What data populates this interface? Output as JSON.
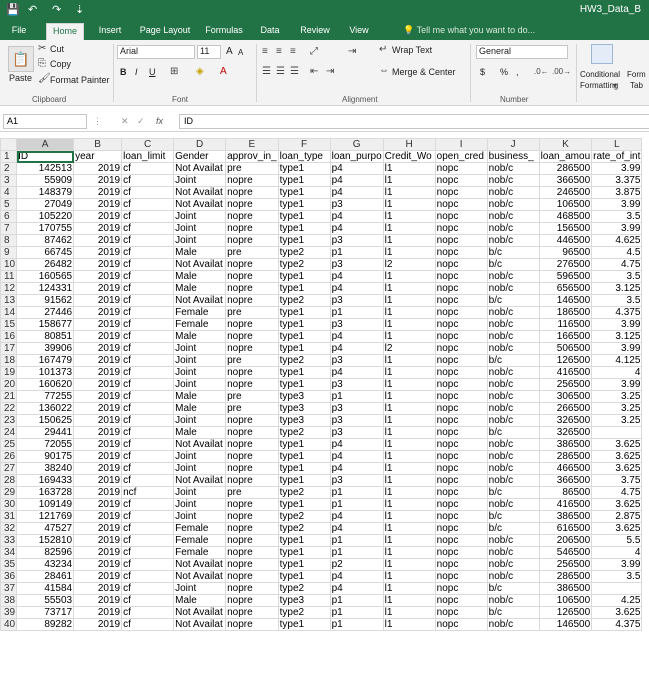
{
  "window": {
    "title": "HW3_Data_B",
    "quick_access": [
      "💾",
      "↶",
      "↷",
      "⇣"
    ]
  },
  "ribbon_tabs": [
    "File",
    "Home",
    "Insert",
    "Page Layout",
    "Formulas",
    "Data",
    "Review",
    "View"
  ],
  "tell_me": "Tell me what you want to do...",
  "clipboard": {
    "paste": "Paste",
    "cut": "Cut",
    "copy": "Copy",
    "format_painter": "Format Painter",
    "group": "Clipboard"
  },
  "font": {
    "name": "Arial",
    "size": "11",
    "bold": "B",
    "italic": "I",
    "underline": "U",
    "grow": "A",
    "shrink": "A",
    "group": "Font"
  },
  "alignment": {
    "wrap": "Wrap Text",
    "merge": "Merge & Center",
    "group": "Alignment"
  },
  "number": {
    "format": "General",
    "currency": "$",
    "percent": "%",
    "comma": ",",
    "group": "Number"
  },
  "styles": {
    "conditional": "Conditional",
    "formatting": "Formatting",
    "format_as": "Form",
    "table": "Tab"
  },
  "formula_bar": {
    "cell_ref": "A1",
    "cancel": "✕",
    "enter": "✓",
    "fx": "fx",
    "content": "ID"
  },
  "columns": [
    "A",
    "B",
    "C",
    "D",
    "E",
    "F",
    "G",
    "H",
    "I",
    "J",
    "K",
    "L"
  ],
  "header_row": [
    "ID",
    "year",
    "loan_limit",
    "Gender",
    "approv_in_",
    "loan_type",
    "loan_purpo",
    "Credit_Wo",
    "open_cred",
    "business_",
    "loan_amou",
    "rate_of_int"
  ],
  "rows": [
    [
      "142513",
      "2019",
      "cf",
      "Not Availat",
      "pre",
      "type1",
      "p4",
      "l1",
      "nopc",
      "nob/c",
      "286500",
      "3.99"
    ],
    [
      "55909",
      "2019",
      "cf",
      "Joint",
      "nopre",
      "type1",
      "p4",
      "l1",
      "nopc",
      "nob/c",
      "366500",
      "3.375"
    ],
    [
      "148379",
      "2019",
      "cf",
      "Not Availat",
      "nopre",
      "type1",
      "p4",
      "l1",
      "nopc",
      "nob/c",
      "246500",
      "3.875"
    ],
    [
      "27049",
      "2019",
      "cf",
      "Not Availat",
      "nopre",
      "type1",
      "p3",
      "l1",
      "nopc",
      "nob/c",
      "106500",
      "3.99"
    ],
    [
      "105220",
      "2019",
      "cf",
      "Joint",
      "nopre",
      "type1",
      "p4",
      "l1",
      "nopc",
      "nob/c",
      "468500",
      "3.5"
    ],
    [
      "170755",
      "2019",
      "cf",
      "Joint",
      "nopre",
      "type1",
      "p4",
      "l1",
      "nopc",
      "nob/c",
      "156500",
      "3.99"
    ],
    [
      "87462",
      "2019",
      "cf",
      "Joint",
      "nopre",
      "type1",
      "p3",
      "l1",
      "nopc",
      "nob/c",
      "446500",
      "4.625"
    ],
    [
      "66745",
      "2019",
      "cf",
      "Male",
      "pre",
      "type2",
      "p1",
      "l1",
      "nopc",
      "b/c",
      "96500",
      "4.5"
    ],
    [
      "26482",
      "2019",
      "cf",
      "Not Availat",
      "nopre",
      "type2",
      "p3",
      "l2",
      "nopc",
      "b/c",
      "276500",
      "4.75"
    ],
    [
      "160565",
      "2019",
      "cf",
      "Male",
      "nopre",
      "type1",
      "p4",
      "l1",
      "nopc",
      "nob/c",
      "596500",
      "3.5"
    ],
    [
      "124331",
      "2019",
      "cf",
      "Male",
      "nopre",
      "type1",
      "p4",
      "l1",
      "nopc",
      "nob/c",
      "656500",
      "3.125"
    ],
    [
      "91562",
      "2019",
      "cf",
      "Not Availat",
      "nopre",
      "type2",
      "p3",
      "l1",
      "nopc",
      "b/c",
      "146500",
      "3.5"
    ],
    [
      "27446",
      "2019",
      "cf",
      "Female",
      "pre",
      "type1",
      "p1",
      "l1",
      "nopc",
      "nob/c",
      "186500",
      "4.375"
    ],
    [
      "158677",
      "2019",
      "cf",
      "Female",
      "nopre",
      "type1",
      "p3",
      "l1",
      "nopc",
      "nob/c",
      "116500",
      "3.99"
    ],
    [
      "80851",
      "2019",
      "cf",
      "Male",
      "nopre",
      "type1",
      "p4",
      "l1",
      "nopc",
      "nob/c",
      "166500",
      "3.125"
    ],
    [
      "39906",
      "2019",
      "cf",
      "Joint",
      "nopre",
      "type1",
      "p4",
      "l2",
      "nopc",
      "nob/c",
      "506500",
      "3.99"
    ],
    [
      "167479",
      "2019",
      "cf",
      "Joint",
      "pre",
      "type2",
      "p3",
      "l1",
      "nopc",
      "b/c",
      "126500",
      "4.125"
    ],
    [
      "101373",
      "2019",
      "cf",
      "Joint",
      "nopre",
      "type1",
      "p4",
      "l1",
      "nopc",
      "nob/c",
      "416500",
      "4"
    ],
    [
      "160620",
      "2019",
      "cf",
      "Joint",
      "nopre",
      "type1",
      "p3",
      "l1",
      "nopc",
      "nob/c",
      "256500",
      "3.99"
    ],
    [
      "77255",
      "2019",
      "cf",
      "Male",
      "pre",
      "type3",
      "p1",
      "l1",
      "nopc",
      "nob/c",
      "306500",
      "3.25"
    ],
    [
      "136022",
      "2019",
      "cf",
      "Male",
      "pre",
      "type3",
      "p3",
      "l1",
      "nopc",
      "nob/c",
      "266500",
      "3.25"
    ],
    [
      "150625",
      "2019",
      "cf",
      "Joint",
      "nopre",
      "type3",
      "p3",
      "l1",
      "nopc",
      "nob/c",
      "326500",
      "3.25"
    ],
    [
      "29441",
      "2019",
      "cf",
      "Male",
      "nopre",
      "type2",
      "p3",
      "l1",
      "nopc",
      "b/c",
      "326500",
      ""
    ],
    [
      "72055",
      "2019",
      "cf",
      "Not Availat",
      "nopre",
      "type1",
      "p4",
      "l1",
      "nopc",
      "nob/c",
      "386500",
      "3.625"
    ],
    [
      "90175",
      "2019",
      "cf",
      "Joint",
      "nopre",
      "type1",
      "p4",
      "l1",
      "nopc",
      "nob/c",
      "286500",
      "3.625"
    ],
    [
      "38240",
      "2019",
      "cf",
      "Joint",
      "nopre",
      "type1",
      "p4",
      "l1",
      "nopc",
      "nob/c",
      "466500",
      "3.625"
    ],
    [
      "169433",
      "2019",
      "cf",
      "Not Availat",
      "nopre",
      "type1",
      "p3",
      "l1",
      "nopc",
      "nob/c",
      "366500",
      "3.75"
    ],
    [
      "163728",
      "2019",
      "ncf",
      "Joint",
      "pre",
      "type2",
      "p1",
      "l1",
      "nopc",
      "b/c",
      "86500",
      "4.75"
    ],
    [
      "109149",
      "2019",
      "cf",
      "Joint",
      "nopre",
      "type1",
      "p1",
      "l1",
      "nopc",
      "nob/c",
      "416500",
      "3.625"
    ],
    [
      "121769",
      "2019",
      "cf",
      "Joint",
      "nopre",
      "type2",
      "p4",
      "l1",
      "nopc",
      "b/c",
      "386500",
      "2.875"
    ],
    [
      "47527",
      "2019",
      "cf",
      "Female",
      "nopre",
      "type2",
      "p4",
      "l1",
      "nopc",
      "b/c",
      "616500",
      "3.625"
    ],
    [
      "152810",
      "2019",
      "cf",
      "Female",
      "nopre",
      "type1",
      "p1",
      "l1",
      "nopc",
      "nob/c",
      "206500",
      "5.5"
    ],
    [
      "82596",
      "2019",
      "cf",
      "Female",
      "nopre",
      "type1",
      "p1",
      "l1",
      "nopc",
      "nob/c",
      "546500",
      "4"
    ],
    [
      "43234",
      "2019",
      "cf",
      "Not Availat",
      "nopre",
      "type1",
      "p2",
      "l1",
      "nopc",
      "nob/c",
      "256500",
      "3.99"
    ],
    [
      "28461",
      "2019",
      "cf",
      "Not Availat",
      "nopre",
      "type1",
      "p4",
      "l1",
      "nopc",
      "nob/c",
      "286500",
      "3.5"
    ],
    [
      "41584",
      "2019",
      "cf",
      "Joint",
      "nopre",
      "type2",
      "p4",
      "l1",
      "nopc",
      "b/c",
      "386500",
      ""
    ],
    [
      "55503",
      "2019",
      "cf",
      "Male",
      "nopre",
      "type3",
      "p1",
      "l1",
      "nopc",
      "nob/c",
      "106500",
      "4.25"
    ],
    [
      "73717",
      "2019",
      "cf",
      "Not Availat",
      "nopre",
      "type2",
      "p1",
      "l1",
      "nopc",
      "b/c",
      "126500",
      "3.625"
    ],
    [
      "89282",
      "2019",
      "cf",
      "Not Availat",
      "nopre",
      "type1",
      "p1",
      "l1",
      "nopc",
      "nob/c",
      "146500",
      "4.375"
    ]
  ]
}
